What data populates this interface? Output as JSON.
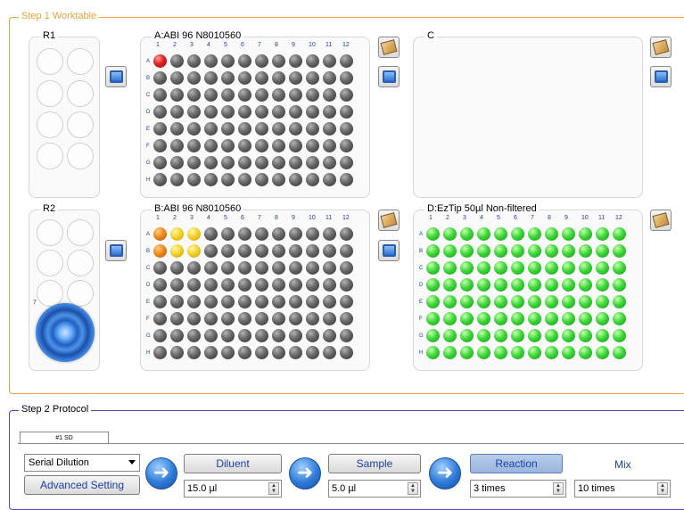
{
  "step1": {
    "title": "Step 1 Worktable"
  },
  "step2": {
    "title": "Step 2 Protocol"
  },
  "r1": {
    "label": "R1"
  },
  "r2": {
    "label": "R2",
    "slot_number": "7"
  },
  "plate_a": {
    "label": "A:ABI 96 N8010560"
  },
  "plate_b": {
    "label": "B:ABI 96 N8010560"
  },
  "slot_c": {
    "label": "C"
  },
  "plate_d": {
    "label": "D:EzTip 50µl Non-filtered"
  },
  "columns": [
    "1",
    "2",
    "3",
    "4",
    "5",
    "6",
    "7",
    "8",
    "9",
    "10",
    "11",
    "12"
  ],
  "rows": [
    "A",
    "B",
    "C",
    "D",
    "E",
    "F",
    "G",
    "H"
  ],
  "protocol": {
    "tab_label": "#1 SD",
    "method": "Serial Dilution",
    "advanced_label": "Advanced Setting",
    "diluent_label": "Diluent",
    "diluent_value": "15.0 µl",
    "sample_label": "Sample",
    "sample_value": "5.0 µl",
    "reaction_label": "Reaction",
    "reaction_value": "3 times",
    "mix_label": "Mix",
    "mix_value": "10 times"
  },
  "well_states": {
    "plate_a": {
      "A1": "red"
    },
    "plate_b": {
      "A1": "orange",
      "A2": "yellow",
      "A3": "yellow",
      "B1": "orange",
      "B2": "yellow",
      "B3": "yellow"
    },
    "plate_d": "all-green"
  },
  "colors": {
    "step1_border": "#e8a33c",
    "step2_border": "#4a4ad0"
  }
}
